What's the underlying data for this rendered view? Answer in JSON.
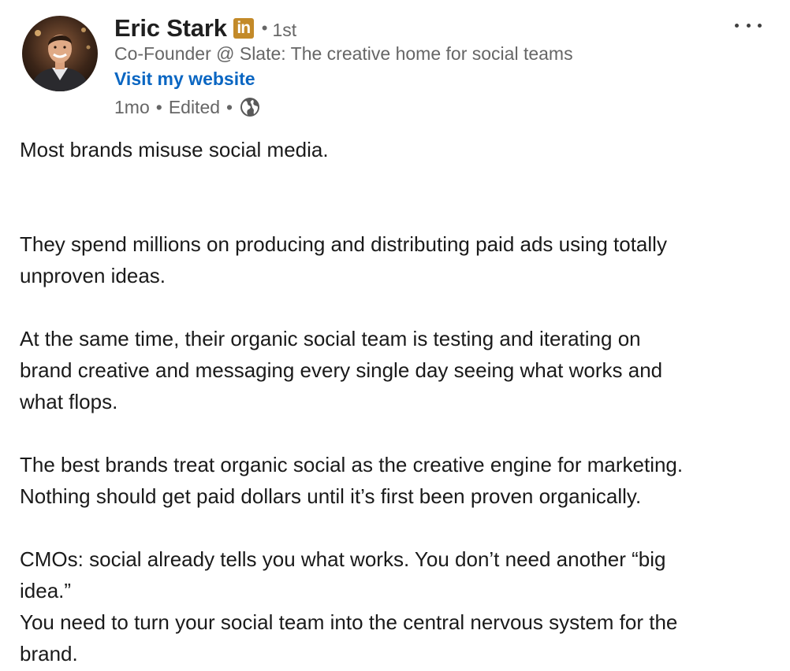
{
  "author": {
    "name": "Eric Stark",
    "badge": "in",
    "separator": "•",
    "connection_degree": "1st",
    "headline": "Co-Founder @ Slate: The creative home for social teams",
    "website_link": "Visit my website"
  },
  "meta": {
    "time": "1mo",
    "edited": "Edited",
    "separator": "•",
    "visibility_icon": "globe-icon"
  },
  "post": {
    "paragraphs": [
      "Most brands misuse social media.",
      "They spend millions on producing and distributing paid ads using totally\nunproven ideas.",
      "At the same time, their organic social team is testing and iterating on\nbrand creative and messaging every single day seeing what works and\nwhat flops.",
      "The best brands treat organic social as the creative engine for marketing.\nNothing should get paid dollars until it’s first been proven organically.",
      "CMOs: social already tells you what works. You don’t need another “big\nidea.”\nYou need to turn your social team into the central nervous system for the\nbrand."
    ]
  },
  "colors": {
    "link": "#0a66c2",
    "premium_badge": "#c38a29",
    "secondary_text": "#666666"
  }
}
